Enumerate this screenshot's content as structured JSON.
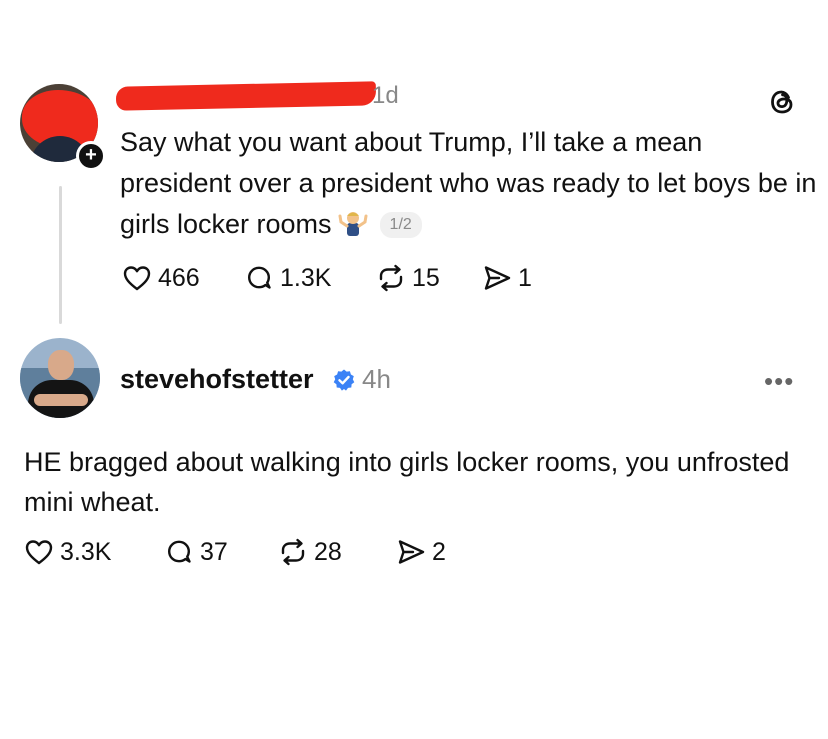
{
  "post1": {
    "time": "1d",
    "text": "Say what you want about Trump, I’ll take a mean president over a president who was ready to let boys be in girls locker rooms",
    "emoji": "person-shrugging-emoji",
    "page_indicator": "1/2",
    "likes": "466",
    "replies": "1.3K",
    "reposts": "15",
    "shares": "1"
  },
  "post2": {
    "username": "stevehofstetter",
    "time": "4h",
    "more": "•••",
    "text": "HE bragged about walking into girls locker rooms, you unfrosted mini wheat.",
    "likes": "3.3K",
    "replies": "37",
    "reposts": "28",
    "shares": "2"
  },
  "ui": {
    "follow_badge": "+",
    "redaction_color": "#ef2a1d",
    "verified_color": "#3b82f6",
    "icons": [
      "threads-logo-icon",
      "heart-icon",
      "comment-icon",
      "repost-icon",
      "share-icon",
      "verified-icon",
      "more-icon"
    ]
  }
}
